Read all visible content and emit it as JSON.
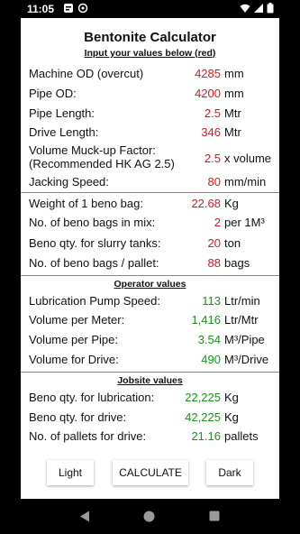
{
  "status": {
    "time": "11:05"
  },
  "app": {
    "title": "Bentonite Calculator",
    "subtitle": "Input your values below (red)"
  },
  "inputs": [
    {
      "label": "Machine OD (overcut)",
      "value": "4285",
      "unit": "mm"
    },
    {
      "label": "Pipe OD:",
      "value": "4200",
      "unit": "mm"
    },
    {
      "label": "Pipe Length:",
      "value": "2.5",
      "unit": "Mtr"
    },
    {
      "label": "Drive Length:",
      "value": "346",
      "unit": "Mtr"
    },
    {
      "label": "Volume Muck-up Factor:",
      "label2": "(Recommended HK AG 2.5)",
      "value": "2.5",
      "unit": "x volume"
    },
    {
      "label": "Jacking Speed:",
      "value": "80",
      "unit": "mm/min"
    }
  ],
  "bag_inputs": [
    {
      "label": "Weight of 1 beno bag:",
      "value": "22.68",
      "unit": "Kg"
    },
    {
      "label": "No. of beno bags in mix:",
      "value": "2",
      "unit": "per 1M³"
    },
    {
      "label": "Beno qty. for slurry tanks:",
      "value": "20",
      "unit": "ton"
    },
    {
      "label": "No. of beno bags / pallet:",
      "value": "88",
      "unit": "bags"
    }
  ],
  "operator": {
    "title": "Operator values",
    "rows": [
      {
        "label": "Lubrication Pump Speed:",
        "value": "113",
        "unit": "Ltr/min"
      },
      {
        "label": "Volume per Meter:",
        "value": "1,416",
        "unit": "Ltr/Mtr"
      },
      {
        "label": "Volume per Pipe:",
        "value": "3.54",
        "unit": "M³/Pipe"
      },
      {
        "label": "Volume for Drive:",
        "value": "490",
        "unit": "M³/Drive"
      }
    ]
  },
  "jobsite": {
    "title": "Jobsite values",
    "rows": [
      {
        "label": "Beno qty. for lubrication:",
        "value": "22,225",
        "unit": "Kg"
      },
      {
        "label": "Beno qty. for drive:",
        "value": "42,225",
        "unit": "Kg"
      },
      {
        "label": "No. of pallets for drive:",
        "value": "21.16",
        "unit": "pallets"
      }
    ]
  },
  "buttons": {
    "light": "Light",
    "calculate": "CALCULATE",
    "dark": "Dark"
  },
  "colors": {
    "input": "#d41a24",
    "output": "#1f8f1f"
  }
}
